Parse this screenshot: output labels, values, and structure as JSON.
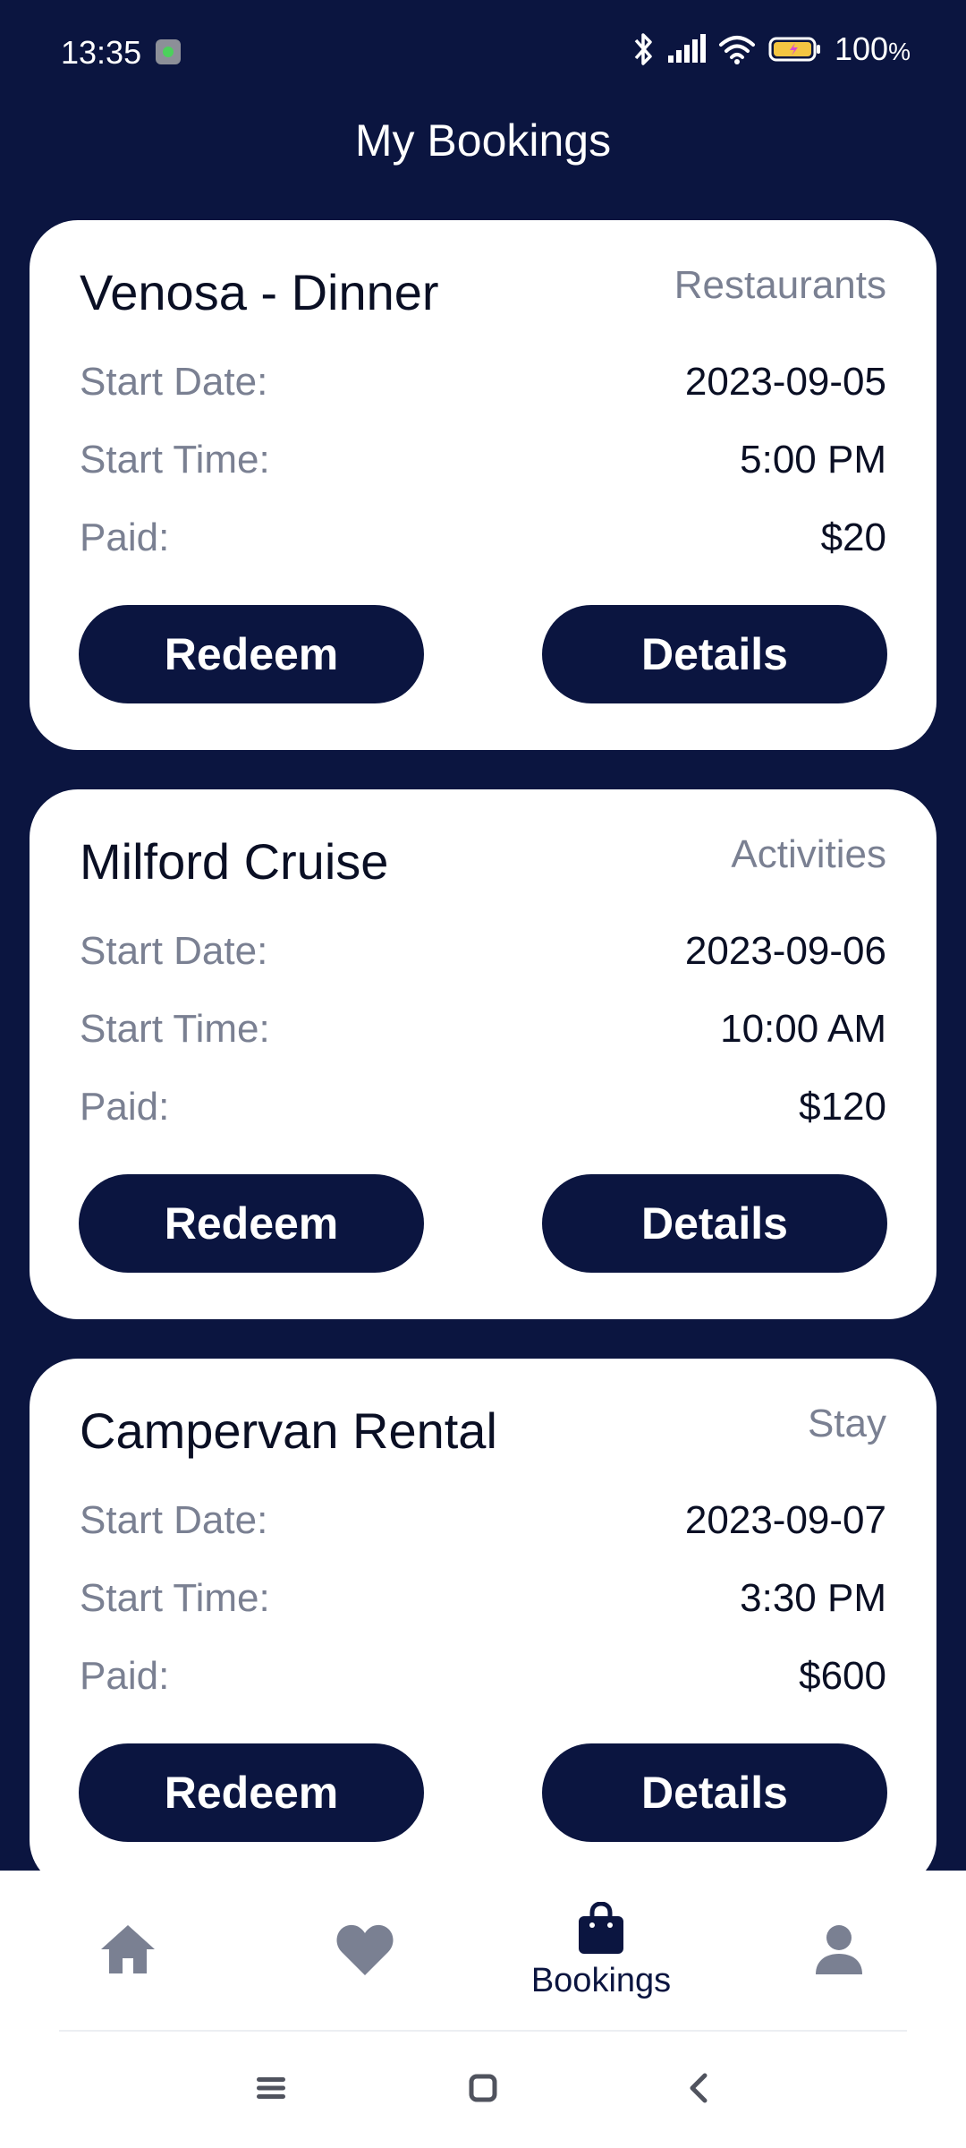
{
  "status_bar": {
    "time": "13:35",
    "battery": "100"
  },
  "header": {
    "title": "My Bookings"
  },
  "field_labels": {
    "start_date": "Start Date:",
    "start_time": "Start Time:",
    "paid": "Paid:"
  },
  "bookings": [
    {
      "title": "Venosa - Dinner",
      "category": "Restaurants",
      "start_date": "2023-09-05",
      "start_time": "5:00 PM",
      "paid": "$20",
      "redeem_label": "Redeem",
      "details_label": "Details"
    },
    {
      "title": "Milford Cruise",
      "category": "Activities",
      "start_date": "2023-09-06",
      "start_time": "10:00 AM",
      "paid": "$120",
      "redeem_label": "Redeem",
      "details_label": "Details"
    },
    {
      "title": "Campervan Rental",
      "category": "Stay",
      "start_date": "2023-09-07",
      "start_time": "3:30 PM",
      "paid": "$600",
      "redeem_label": "Redeem",
      "details_label": "Details"
    }
  ],
  "bottom_nav": {
    "active": "bookings",
    "items": [
      {
        "id": "home",
        "icon": "home-icon"
      },
      {
        "id": "favorites",
        "icon": "heart-icon"
      },
      {
        "id": "bookings",
        "icon": "shopping-bag-icon",
        "label": "Bookings"
      },
      {
        "id": "profile",
        "icon": "person-icon"
      }
    ]
  },
  "colors": {
    "background": "#0b1540",
    "card": "#ffffff",
    "muted_text": "#7a8092",
    "inactive_icon": "#7a8092",
    "active_icon": "#0b1540"
  }
}
